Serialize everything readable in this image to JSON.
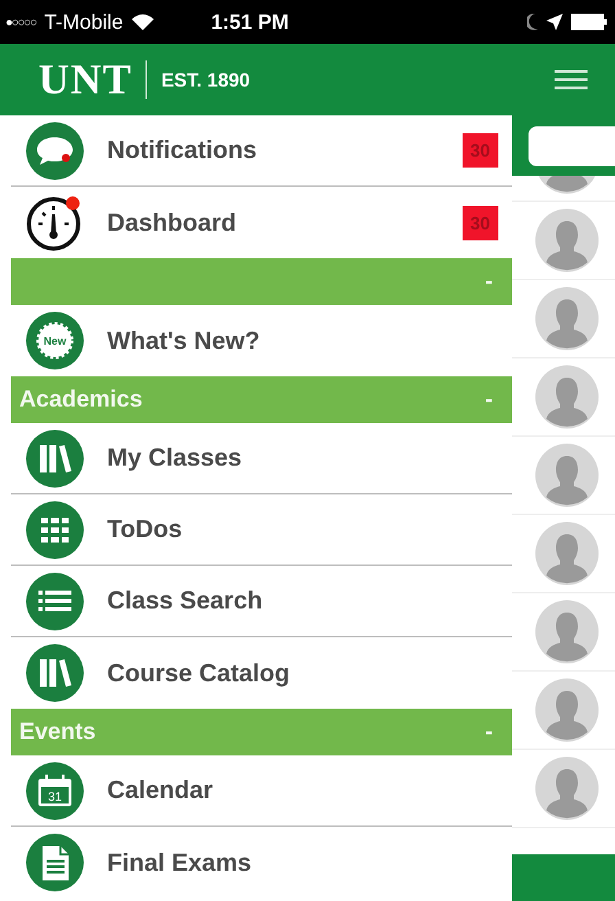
{
  "status_bar": {
    "signal": "●○○○○",
    "carrier": "T-Mobile",
    "time": "1:51 PM"
  },
  "header": {
    "logo": "UNT",
    "tagline": "EST. 1890"
  },
  "menu": [
    {
      "kind": "item",
      "label": "Notifications",
      "badge": "30"
    },
    {
      "kind": "item",
      "label": "Dashboard",
      "badge": "30"
    },
    {
      "kind": "section",
      "toggle": "-"
    },
    {
      "kind": "item",
      "label": "What's New?",
      "icon_text": "New"
    },
    {
      "kind": "section",
      "label": "Academics",
      "toggle": "-"
    },
    {
      "kind": "item",
      "label": "My Classes"
    },
    {
      "kind": "item",
      "label": "ToDos"
    },
    {
      "kind": "item",
      "label": "Class Search"
    },
    {
      "kind": "item",
      "label": "Course Catalog"
    },
    {
      "kind": "section",
      "label": "Events",
      "toggle": "-"
    },
    {
      "kind": "item",
      "label": "Calendar",
      "icon_text": "31"
    },
    {
      "kind": "item",
      "label": "Final Exams"
    }
  ]
}
